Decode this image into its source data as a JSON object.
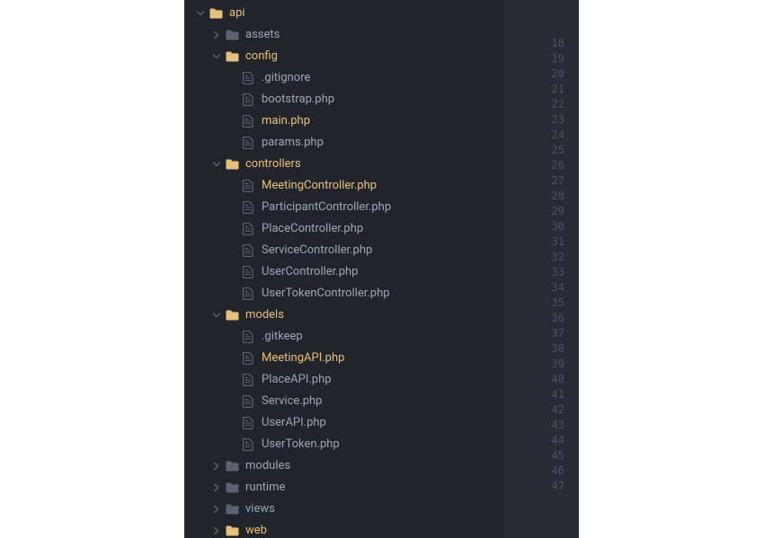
{
  "tree": [
    {
      "depth": 0,
      "type": "folder",
      "expanded": true,
      "label": "api",
      "highlight": true
    },
    {
      "depth": 1,
      "type": "folder",
      "expanded": false,
      "label": "assets",
      "highlight": false
    },
    {
      "depth": 1,
      "type": "folder",
      "expanded": true,
      "label": "config",
      "highlight": true
    },
    {
      "depth": 2,
      "type": "file",
      "label": ".gitignore",
      "highlight": false
    },
    {
      "depth": 2,
      "type": "file",
      "label": "bootstrap.php",
      "highlight": false
    },
    {
      "depth": 2,
      "type": "file",
      "label": "main.php",
      "highlight": true
    },
    {
      "depth": 2,
      "type": "file",
      "label": "params.php",
      "highlight": false
    },
    {
      "depth": 1,
      "type": "folder",
      "expanded": true,
      "label": "controllers",
      "highlight": true
    },
    {
      "depth": 2,
      "type": "file",
      "label": "MeetingController.php",
      "highlight": true
    },
    {
      "depth": 2,
      "type": "file",
      "label": "ParticipantController.php",
      "highlight": false
    },
    {
      "depth": 2,
      "type": "file",
      "label": "PlaceController.php",
      "highlight": false
    },
    {
      "depth": 2,
      "type": "file",
      "label": "ServiceController.php",
      "highlight": false
    },
    {
      "depth": 2,
      "type": "file",
      "label": "UserController.php",
      "highlight": false
    },
    {
      "depth": 2,
      "type": "file",
      "label": "UserTokenController.php",
      "highlight": false
    },
    {
      "depth": 1,
      "type": "folder",
      "expanded": true,
      "label": "models",
      "highlight": true
    },
    {
      "depth": 2,
      "type": "file",
      "label": ".gitkeep",
      "highlight": false
    },
    {
      "depth": 2,
      "type": "file",
      "label": "MeetingAPI.php",
      "highlight": true
    },
    {
      "depth": 2,
      "type": "file",
      "label": "PlaceAPI.php",
      "highlight": false
    },
    {
      "depth": 2,
      "type": "file",
      "label": "Service.php",
      "highlight": false
    },
    {
      "depth": 2,
      "type": "file",
      "label": "UserAPI.php",
      "highlight": false
    },
    {
      "depth": 2,
      "type": "file",
      "label": "UserToken.php",
      "highlight": false
    },
    {
      "depth": 1,
      "type": "folder",
      "expanded": false,
      "label": "modules",
      "highlight": false
    },
    {
      "depth": 1,
      "type": "folder",
      "expanded": false,
      "label": "runtime",
      "highlight": false
    },
    {
      "depth": 1,
      "type": "folder",
      "expanded": false,
      "label": "views",
      "highlight": false
    },
    {
      "depth": 1,
      "type": "folder",
      "expanded": false,
      "label": "web",
      "highlight": true
    }
  ],
  "gutter": {
    "start": 18,
    "end": 47
  }
}
